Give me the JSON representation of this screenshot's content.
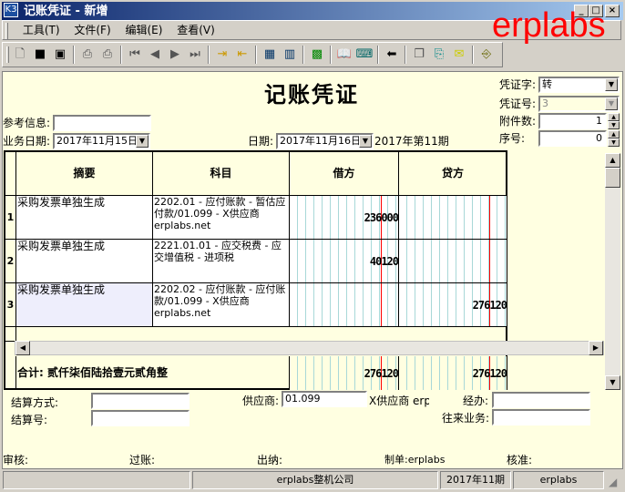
{
  "window": {
    "title": "记账凭证 - 新增",
    "app_icon": "K3",
    "watermark": "erplabs"
  },
  "menu": [
    "工具(T)",
    "文件(F)",
    "编辑(E)",
    "查看(V)"
  ],
  "toolbar_icons": [
    "new-icon",
    "save-icon",
    "save-new-icon",
    "preview-icon",
    "print-icon",
    "first-icon",
    "prev-icon",
    "next-icon",
    "last-icon",
    "insert-row-icon",
    "delete-row-icon",
    "calculator-icon",
    "book-icon",
    "book2-icon",
    "grid-icon",
    "open-book-icon",
    "keyboard-icon",
    "back-arrow-icon",
    "copy-icon",
    "attach-icon",
    "mail-icon",
    "exit-icon"
  ],
  "header": {
    "title": "记账凭证",
    "ref_label": "参考信息:",
    "ref_value": "",
    "biz_date_label": "业务日期:",
    "biz_date": "2017年11月15日",
    "date_label": "日期:",
    "date": "2017年11月16日",
    "period": "2017年第11期",
    "voucher_word_label": "凭证字:",
    "voucher_word": "转",
    "voucher_no_label": "凭证号:",
    "voucher_no": "3",
    "attach_label": "附件数:",
    "attach": "1",
    "seq_label": "序号:",
    "seq": "0"
  },
  "grid": {
    "columns": [
      "摘要",
      "科目",
      "借方",
      "贷方"
    ],
    "rows": [
      {
        "no": "1",
        "summary": "采购发票单独生成",
        "account": "2202.01 - 应付账款 - 暂估应付款/01.099 - X供应商 erplabs.net",
        "debit": "236000",
        "credit": ""
      },
      {
        "no": "2",
        "summary": "采购发票单独生成",
        "account": "2221.01.01 - 应交税费 - 应交增值税 - 进项税",
        "debit": "40120",
        "credit": ""
      },
      {
        "no": "3",
        "summary": "采购发票单独生成",
        "account": "2202.02 - 应付账款 - 应付账款/01.099 - X供应商 erplabs.net",
        "debit": "",
        "credit": "276120"
      }
    ],
    "total_label": "合计: 贰仟柒佰陆拾壹元贰角整",
    "total_debit": "276120",
    "total_credit": "276120"
  },
  "footer": {
    "settle_method_label": "结算方式:",
    "settle_no_label": "结算号:",
    "supplier_label": "供应商:",
    "supplier_code": "01.099",
    "supplier_name": "X供应商 erp",
    "handler_label": "经办:",
    "business_label": "往来业务:"
  },
  "signatures": {
    "audit": "审核:",
    "post": "过账:",
    "cashier": "出纳:",
    "maker": "制单:erplabs",
    "approve": "核准:"
  },
  "statusbar": {
    "blank": "",
    "company": "erplabs整机公司",
    "period": "2017年11期",
    "user": "erplabs"
  }
}
